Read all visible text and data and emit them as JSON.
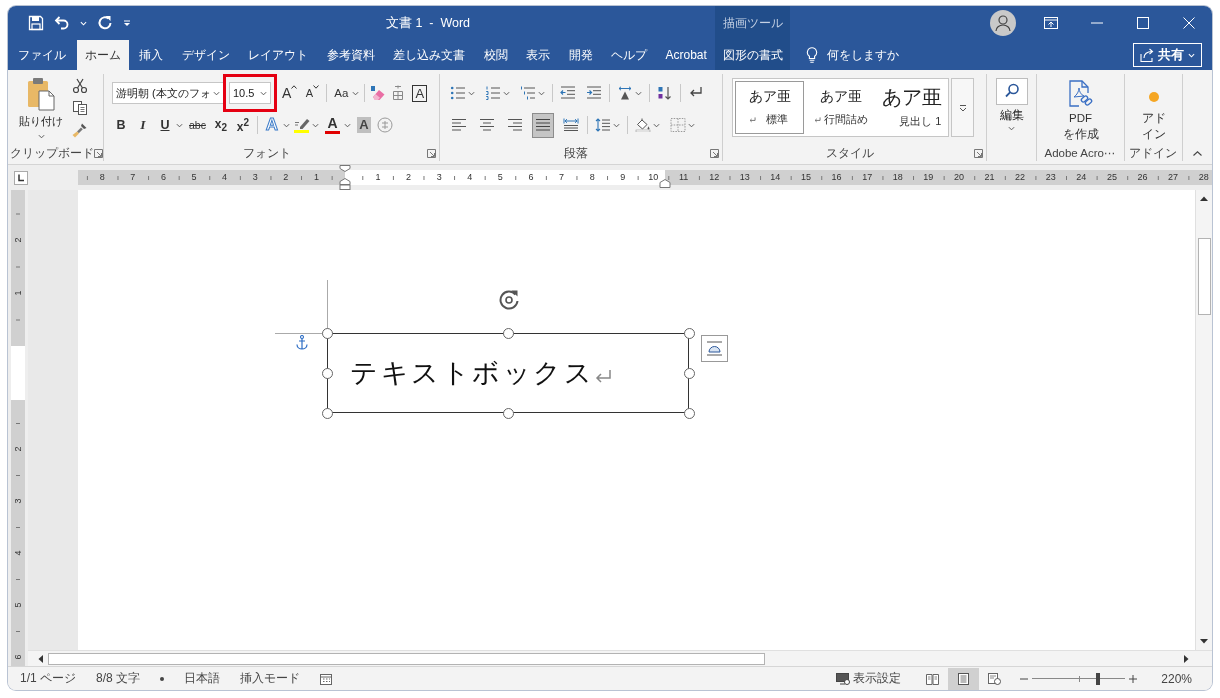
{
  "title_bar": {
    "title": "文書 1  -  Word",
    "context_label": "描画ツール"
  },
  "ribbon_tabs": [
    {
      "label": "ファイル",
      "selected": false,
      "kind": "normal"
    },
    {
      "label": "ホーム",
      "selected": true,
      "kind": "normal"
    },
    {
      "label": "挿入",
      "selected": false,
      "kind": "normal"
    },
    {
      "label": "デザイン",
      "selected": false,
      "kind": "normal"
    },
    {
      "label": "レイアウト",
      "selected": false,
      "kind": "normal"
    },
    {
      "label": "参考資料",
      "selected": false,
      "kind": "normal"
    },
    {
      "label": "差し込み文書",
      "selected": false,
      "kind": "normal"
    },
    {
      "label": "校閲",
      "selected": false,
      "kind": "normal"
    },
    {
      "label": "表示",
      "selected": false,
      "kind": "normal"
    },
    {
      "label": "開発",
      "selected": false,
      "kind": "normal"
    },
    {
      "label": "ヘルプ",
      "selected": false,
      "kind": "normal"
    },
    {
      "label": "Acrobat",
      "selected": false,
      "kind": "normal"
    },
    {
      "label": "図形の書式",
      "selected": false,
      "kind": "contextual"
    }
  ],
  "tell_me": "何をしますか",
  "share_button": "共有",
  "clipboard": {
    "paste_label": "貼り付け",
    "group_label": "クリップボード"
  },
  "font": {
    "font_name": "游明朝 (本文のフォ",
    "font_size": "10.5",
    "font_size_annotated": true,
    "row_1": [
      [
        {
          "kind": "grow",
          "label": "A",
          "dropdown": false
        },
        {
          "kind": "shrink",
          "label": "A",
          "dropdown": false
        }
      ],
      [
        {
          "kind": "case",
          "label": "Aa",
          "dropdown": true
        }
      ],
      [
        {
          "kind": "clear",
          "dropdown": false
        },
        {
          "kind": "phonetic",
          "dropdown": false
        },
        {
          "kind": "border",
          "label": "A",
          "dropdown": false
        }
      ]
    ],
    "row_2": [
      [
        {
          "kind": "bold",
          "label": "B",
          "dropdown": false
        },
        {
          "kind": "italic",
          "label": "I",
          "dropdown": false
        },
        {
          "kind": "underline",
          "label": "U",
          "dropdown": true
        },
        {
          "kind": "strike",
          "label": "abc",
          "dropdown": false
        },
        {
          "kind": "subscript",
          "label": "x$_{2}$",
          "dropdown": false
        },
        {
          "kind": "superscript",
          "label": "x$^{2}$",
          "dropdown": false
        }
      ],
      [
        {
          "kind": "effects",
          "label": "A",
          "dropdown": true
        },
        {
          "kind": "highlight",
          "color": "#ffff00",
          "dropdown": true
        },
        {
          "kind": "font_color",
          "label": "A",
          "color": "#e00000",
          "dropdown": true
        },
        {
          "kind": "shading",
          "label": "A",
          "dropdown": false
        },
        {
          "kind": "enclose",
          "dropdown": false
        }
      ]
    ],
    "group_label": "フォント"
  },
  "paragraph": {
    "row_1": [
      [
        {
          "kind": "bullets",
          "dropdown": true
        },
        {
          "kind": "numbering",
          "dropdown": true
        },
        {
          "kind": "multilevel",
          "dropdown": true
        }
      ],
      [
        {
          "kind": "outdent",
          "dropdown": false
        },
        {
          "kind": "indent",
          "dropdown": false
        }
      ],
      [
        {
          "kind": "asian_layout",
          "dropdown": true
        }
      ],
      [
        {
          "kind": "sort",
          "dropdown": false
        }
      ],
      [
        {
          "kind": "marks",
          "dropdown": false
        }
      ]
    ],
    "alignment": [
      {
        "kind": "left",
        "selected": false
      },
      {
        "kind": "center",
        "selected": false
      },
      {
        "kind": "right",
        "selected": false
      },
      {
        "kind": "justify",
        "selected": true
      },
      {
        "kind": "distributed",
        "selected": false
      }
    ],
    "row_2": [
      [
        {
          "kind": "line_spacing",
          "dropdown": true
        }
      ],
      [
        {
          "kind": "shading",
          "dropdown": true
        },
        {
          "kind": "borders",
          "dropdown": true
        }
      ]
    ],
    "group_label": "段落"
  },
  "styles": {
    "items": [
      {
        "preview": "あア亜",
        "name": "標準",
        "selected": true,
        "kind": "body",
        "paragraph_mark": true
      },
      {
        "preview": "あア亜",
        "name": "行間詰め",
        "selected": false,
        "kind": "body",
        "paragraph_mark": true
      },
      {
        "preview": "あア亜",
        "name": "見出し 1",
        "selected": false,
        "kind": "heading",
        "paragraph_mark": false
      }
    ],
    "group_label": "スタイル"
  },
  "editing": {
    "label": "編集"
  },
  "adobe": {
    "button_lines": [
      "PDF",
      "を作成"
    ],
    "group_label": "Adobe Acro⋯"
  },
  "add_ins": {
    "button_lines": [
      "アド",
      "イン"
    ],
    "group_label": "アドイン"
  },
  "horizontal_ruler": {
    "left_labels": [
      "8",
      "7",
      "6",
      "5",
      "4",
      "3",
      "2",
      "1"
    ],
    "text_labels": [
      "1",
      "2",
      "3",
      "4",
      "5",
      "6",
      "7",
      "8",
      "9",
      "10"
    ],
    "right_labels": [
      "11",
      "12",
      "13",
      "14",
      "15",
      "16",
      "17",
      "18",
      "19",
      "20",
      "21",
      "22",
      "23",
      "24",
      "25",
      "26",
      "27",
      "28"
    ]
  },
  "vertical_ruler": {
    "upper_labels": [
      "2",
      "1"
    ],
    "lower_labels": [
      "2",
      "3",
      "4",
      "5",
      "6"
    ]
  },
  "document": {
    "text_box": "テキストボックス"
  },
  "status_bar": {
    "page": "1/1 ページ",
    "words": "8/8 文字",
    "language": "日本語",
    "input_mode": "挿入モード",
    "display_settings": "表示設定",
    "views": [
      {
        "kind": "read",
        "selected": false
      },
      {
        "kind": "print",
        "selected": true
      },
      {
        "kind": "web",
        "selected": false
      }
    ],
    "zoom": {
      "level": 0.71,
      "reading": "220%"
    }
  }
}
